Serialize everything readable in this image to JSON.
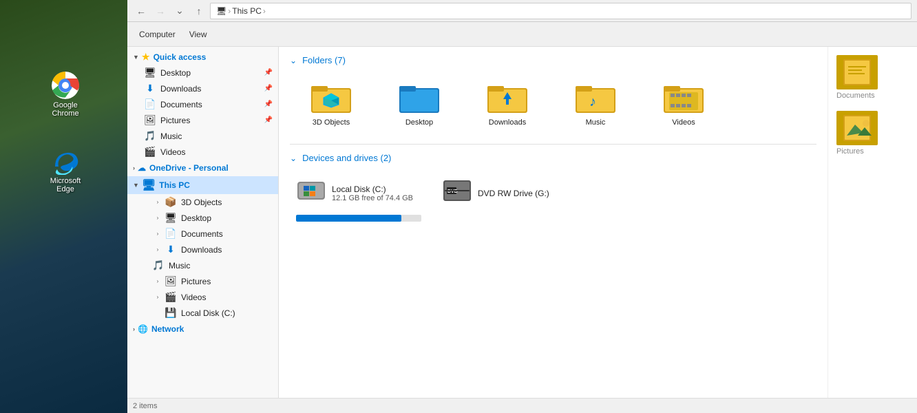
{
  "desktop": {
    "icons": [
      {
        "id": "chrome",
        "label": "Google\nChrome",
        "emoji": "🌐"
      },
      {
        "id": "edge",
        "label": "Microsoft\nEdge",
        "emoji": "🌊"
      }
    ]
  },
  "titlebar": {
    "address_parts": [
      "This PC"
    ],
    "back_disabled": false,
    "forward_disabled": true
  },
  "sidebar": {
    "quick_access_label": "Quick access",
    "quick_access_items": [
      {
        "label": "Desktop",
        "icon": "🖥",
        "pinned": true
      },
      {
        "label": "Downloads",
        "icon": "⬇",
        "pinned": true
      },
      {
        "label": "Documents",
        "icon": "📄",
        "pinned": true
      },
      {
        "label": "Pictures",
        "icon": "🖼",
        "pinned": true
      },
      {
        "label": "Music",
        "icon": "🎵",
        "pinned": false
      },
      {
        "label": "Videos",
        "icon": "🎬",
        "pinned": false
      }
    ],
    "onedrive_label": "OneDrive - Personal",
    "this_pc_label": "This PC",
    "this_pc_items": [
      {
        "label": "3D Objects",
        "icon": "📦"
      },
      {
        "label": "Desktop",
        "icon": "🖥"
      },
      {
        "label": "Documents",
        "icon": "📄"
      },
      {
        "label": "Downloads",
        "icon": "⬇"
      },
      {
        "label": "Music",
        "icon": "🎵"
      },
      {
        "label": "Pictures",
        "icon": "🖼"
      },
      {
        "label": "Videos",
        "icon": "🎬"
      },
      {
        "label": "Local Disk (C:)",
        "icon": "💾"
      }
    ],
    "network_label": "Network"
  },
  "content": {
    "folders_section_label": "Folders (7)",
    "folders": [
      {
        "label": "3D Objects",
        "type": "3d"
      },
      {
        "label": "Desktop",
        "type": "desktop"
      },
      {
        "label": "Downloads",
        "type": "downloads"
      },
      {
        "label": "Music",
        "type": "music"
      },
      {
        "label": "Videos",
        "type": "videos"
      }
    ],
    "devices_section_label": "Devices and drives (2)",
    "devices": [
      {
        "label": "Local Disk (C:)",
        "free_text": "12.1 GB free of 74.4 GB",
        "used_pct": 84,
        "type": "hdd"
      },
      {
        "label": "DVD RW Drive (G:)",
        "free_text": "",
        "type": "dvd"
      }
    ]
  },
  "right_panel": {
    "items": [
      {
        "label": "Documents",
        "type": "doc"
      },
      {
        "label": "Pictures",
        "type": "pic"
      }
    ]
  },
  "statusbar": {
    "text": "2 items"
  }
}
